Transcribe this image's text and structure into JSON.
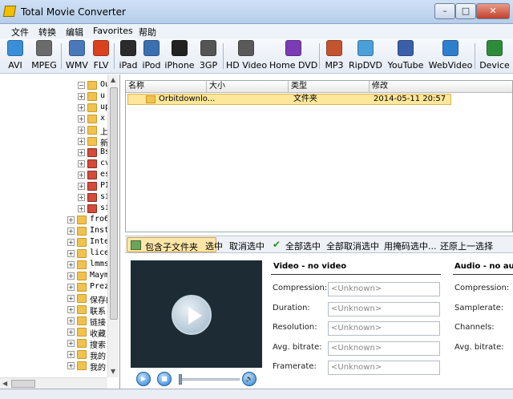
{
  "window": {
    "title": "Total Movie Converter",
    "min_label": "–",
    "max_label": "□",
    "close_label": "✕"
  },
  "menu": [
    "文件",
    "转换",
    "编辑",
    "Favorites",
    "帮助"
  ],
  "toolbar": [
    {
      "label": "AVI",
      "icon": "avi-icon",
      "color": "#3a8fd8"
    },
    {
      "label": "MPEG",
      "icon": "mpeg-icon",
      "color": "#6b6b6b"
    },
    {
      "label": "WMV",
      "icon": "wmv-icon",
      "color": "#4a78b8"
    },
    {
      "label": "FLV",
      "icon": "flv-icon",
      "color": "#d9421f"
    },
    {
      "label": "iPad",
      "icon": "ipad-icon",
      "color": "#2b2b2b"
    },
    {
      "label": "iPod",
      "icon": "ipod-icon",
      "color": "#3a6fb0"
    },
    {
      "label": "iPhone",
      "icon": "iphone-icon",
      "color": "#222222"
    },
    {
      "label": "3GP",
      "icon": "3gp-icon",
      "color": "#555555"
    },
    {
      "label": "HD Video",
      "icon": "hd-video-icon",
      "color": "#5a5a5a"
    },
    {
      "label": "Home DVD",
      "icon": "home-dvd-icon",
      "color": "#7a3bb5"
    },
    {
      "label": "MP3",
      "icon": "mp3-icon",
      "color": "#c4542f"
    },
    {
      "label": "RipDVD",
      "icon": "ripdvd-icon",
      "color": "#4aa0d8"
    },
    {
      "label": "YouTube",
      "icon": "youtube-icon",
      "color": "#3b5fa8"
    },
    {
      "label": "WebVideo",
      "icon": "webvideo-icon",
      "color": "#2f7fcf"
    },
    {
      "label": "Device",
      "icon": "device-icon",
      "color": "#2e8b3a"
    }
  ],
  "tree": [
    {
      "label": "Ou",
      "exp": "−"
    },
    {
      "label": "u",
      "exp": "+"
    },
    {
      "label": "up",
      "exp": "+"
    },
    {
      "label": "x",
      "exp": "+"
    },
    {
      "label": "上",
      "exp": "+"
    },
    {
      "label": "新",
      "exp": "+"
    },
    {
      "label": "Bs",
      "exp": "+"
    },
    {
      "label": "cv",
      "exp": "+"
    },
    {
      "label": "es",
      "exp": "+"
    },
    {
      "label": "PI",
      "exp": "+"
    },
    {
      "label": "si",
      "exp": "+"
    },
    {
      "label": "si",
      "exp": "+"
    },
    {
      "label": "fro6",
      "exp": "+"
    },
    {
      "label": "Inst",
      "exp": "+"
    },
    {
      "label": "Inte",
      "exp": "+"
    },
    {
      "label": "lice",
      "exp": "+"
    },
    {
      "label": "lmms",
      "exp": "+"
    },
    {
      "label": "Mayme",
      "exp": "+"
    },
    {
      "label": "Prez",
      "exp": "+"
    },
    {
      "label": "保存的",
      "exp": "+"
    },
    {
      "label": "联系",
      "exp": "+"
    },
    {
      "label": "链接",
      "exp": "+"
    },
    {
      "label": "收藏",
      "exp": "+"
    },
    {
      "label": "搜索",
      "exp": "+"
    },
    {
      "label": "我的",
      "exp": "+"
    },
    {
      "label": "我的",
      "exp": "+"
    }
  ],
  "file_list": {
    "columns": [
      "名称",
      "大小",
      "类型",
      "修改"
    ],
    "rows": [
      {
        "name": "Orbitdownlo...",
        "size": "",
        "type": "文件夹",
        "modified": "2014-05-11 20:57"
      }
    ]
  },
  "bottom_toolbar": {
    "include_subfolders": "包含子文件夹",
    "select": "选中",
    "unselect": "取消选中",
    "select_all": "全部选中",
    "unselect_all": "全部取消选中",
    "select_by_mask": "用掩码选中...",
    "restore_selection": "还原上一选择"
  },
  "video": {
    "section": "Video - no video",
    "fields": [
      {
        "label": "Compression:",
        "value": "<Unknown>"
      },
      {
        "label": "Duration:",
        "value": "<Unknown>"
      },
      {
        "label": "Resolution:",
        "value": "<Unknown>"
      },
      {
        "label": "Avg. bitrate:",
        "value": "<Unknown>"
      },
      {
        "label": "Framerate:",
        "value": "<Unknown>"
      }
    ]
  },
  "audio": {
    "section": "Audio - no aud",
    "fields": [
      {
        "label": "Compression:"
      },
      {
        "label": "Samplerate:"
      },
      {
        "label": "Channels:"
      },
      {
        "label": "Avg. bitrate:"
      }
    ]
  },
  "player": {
    "play": "▶",
    "stop": "■",
    "volume": "🔊"
  }
}
